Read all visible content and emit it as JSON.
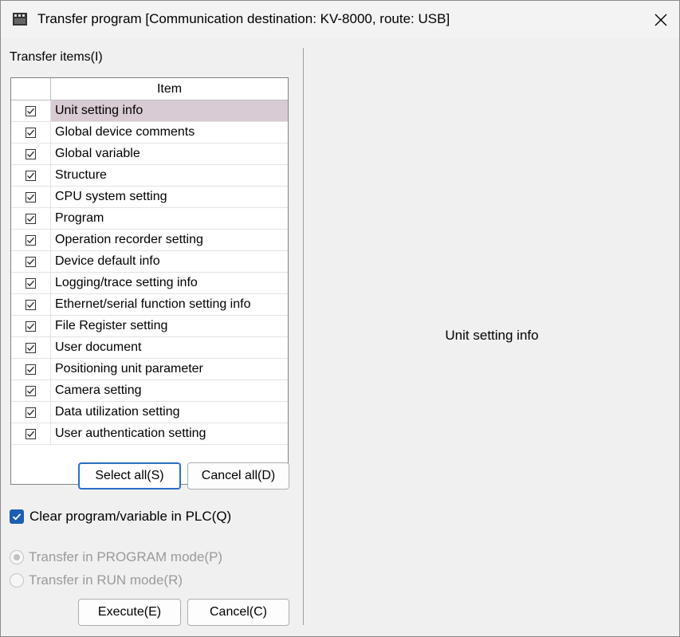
{
  "window": {
    "title": "Transfer program [Communication destination: KV-8000, route: USB]"
  },
  "transfer_items": {
    "label": "Transfer items(I)",
    "column_header": "Item",
    "items": [
      {
        "label": "Unit setting info",
        "checked": true,
        "selected": true
      },
      {
        "label": "Global device comments",
        "checked": true
      },
      {
        "label": "Global variable",
        "checked": true
      },
      {
        "label": "Structure",
        "checked": true
      },
      {
        "label": "CPU system setting",
        "checked": true
      },
      {
        "label": "Program",
        "checked": true
      },
      {
        "label": "Operation recorder setting",
        "checked": true
      },
      {
        "label": "Device default info",
        "checked": true
      },
      {
        "label": "Logging/trace setting info",
        "checked": true
      },
      {
        "label": "Ethernet/serial function setting info",
        "checked": true
      },
      {
        "label": "File Register setting",
        "checked": true
      },
      {
        "label": "User document",
        "checked": true
      },
      {
        "label": "Positioning unit parameter",
        "checked": true
      },
      {
        "label": "Camera setting",
        "checked": true
      },
      {
        "label": "Data utilization setting",
        "checked": true
      },
      {
        "label": "User authentication setting",
        "checked": true
      }
    ]
  },
  "buttons": {
    "select_all": "Select all(S)",
    "cancel_all": "Cancel all(D)",
    "execute": "Execute(E)",
    "cancel": "Cancel(C)"
  },
  "options": {
    "clear_program": {
      "label": "Clear program/variable in PLC(Q)",
      "checked": true
    },
    "mode_program": {
      "label": "Transfer in PROGRAM mode(P)",
      "selected": true,
      "enabled": false
    },
    "mode_run": {
      "label": "Transfer in RUN mode(R)",
      "selected": false,
      "enabled": false
    }
  },
  "detail": {
    "text": "Unit setting info"
  },
  "colors": {
    "accent": "#1a5fb4",
    "selected_row": "#d8cbd3",
    "default_button_border": "#2b6dc8"
  }
}
